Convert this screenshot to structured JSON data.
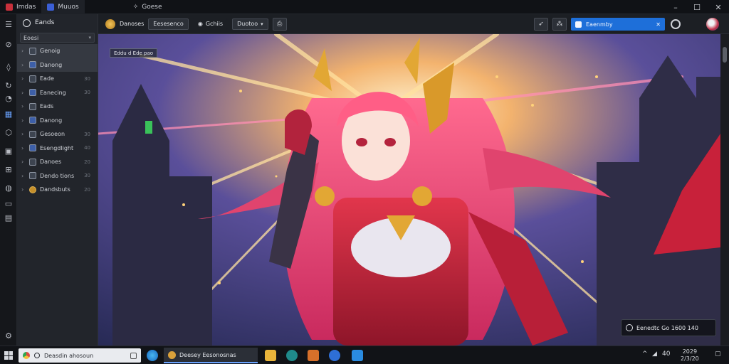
{
  "window": {
    "tabs": [
      {
        "label": "Imdas",
        "active": false
      },
      {
        "label": "Muuos",
        "active": true
      },
      {
        "label": "Goese",
        "active": false
      }
    ]
  },
  "sidebar": {
    "header": "Eands",
    "search_label": "Eoesi",
    "items": [
      {
        "label": "Genoig",
        "count": "",
        "selected": true
      },
      {
        "label": "Danong",
        "count": "",
        "selected": true
      },
      {
        "label": "Eade",
        "count": "30",
        "selected": false
      },
      {
        "label": "Eanecing",
        "count": "30",
        "selected": false
      },
      {
        "label": "Eads",
        "count": "",
        "selected": false
      },
      {
        "label": "Danong",
        "count": "",
        "selected": false
      },
      {
        "label": "Gesoeon",
        "count": "30",
        "selected": false
      },
      {
        "label": "Esengdlight",
        "count": "40",
        "selected": false
      },
      {
        "label": "Danoes",
        "count": "20",
        "selected": false
      },
      {
        "label": "Dendo tions",
        "count": "30",
        "selected": false
      },
      {
        "label": "Dandsbuts",
        "count": "20",
        "selected": false
      }
    ]
  },
  "toolbar": {
    "title": "Danoses",
    "btn1": "Eesesenco",
    "btn2": "Gchiis",
    "btn3": "Duotoo",
    "search_value": "Eaenmby"
  },
  "viewer": {
    "tag": "Eddu d Ede pao",
    "status_text": "Eenedtc Go 1600 140"
  },
  "taskbar": {
    "search_placeholder": "Deasdin ahosoun",
    "app_label": "Deesey Eesonosnas",
    "tray_lang": "40",
    "time": "2029",
    "date": "2/3/20"
  },
  "colors": {
    "accent": "#1e6fd9",
    "sidebar_bg": "#22252b",
    "hair": "#e0446e",
    "armor_red": "#c8213a",
    "gold": "#e2a734"
  }
}
